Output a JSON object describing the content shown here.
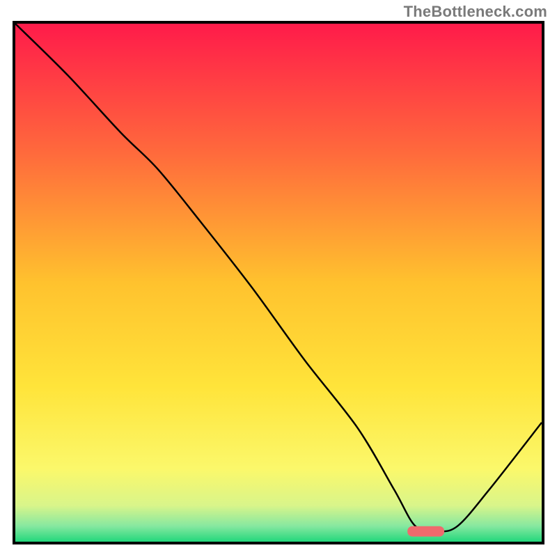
{
  "watermark": "TheBottleneck.com",
  "chart_data": {
    "type": "line",
    "title": "",
    "xlabel": "",
    "ylabel": "",
    "xlim": [
      0,
      100
    ],
    "ylim": [
      0,
      100
    ],
    "grid": false,
    "legend": false,
    "background_gradient": {
      "stops": [
        {
          "offset": 0.0,
          "color": "#ff1b4a"
        },
        {
          "offset": 0.25,
          "color": "#ff6a3c"
        },
        {
          "offset": 0.5,
          "color": "#ffc22e"
        },
        {
          "offset": 0.7,
          "color": "#ffe43a"
        },
        {
          "offset": 0.86,
          "color": "#fbf86b"
        },
        {
          "offset": 0.93,
          "color": "#d9f58a"
        },
        {
          "offset": 0.97,
          "color": "#86e8a0"
        },
        {
          "offset": 1.0,
          "color": "#23d77c"
        }
      ]
    },
    "series": [
      {
        "name": "bottleneck-curve",
        "x": [
          0,
          10,
          20,
          27,
          35,
          45,
          55,
          65,
          72,
          76,
          80,
          84,
          90,
          100
        ],
        "y": [
          100,
          90,
          79,
          72,
          62,
          49,
          35,
          22,
          10,
          3,
          2,
          3,
          10,
          23
        ]
      }
    ],
    "annotations": [
      {
        "name": "sweet-spot-marker",
        "shape": "rounded-bar",
        "x_center": 78,
        "y_center": 2,
        "width_pct": 7,
        "height_pct": 2,
        "color": "#ef6a6d"
      }
    ]
  }
}
